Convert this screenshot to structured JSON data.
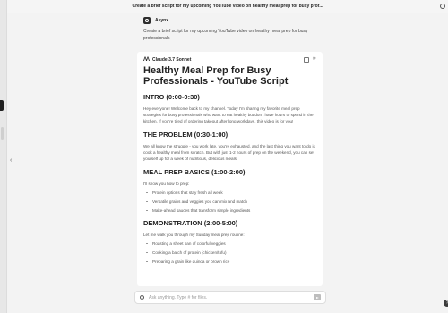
{
  "header": {
    "title": "Create a brief script for my upcoming YouTube video on healthy meal prep for busy prof..."
  },
  "user_message": {
    "name": "Asynx",
    "text": "Create a brief script for my upcoming YouTube video on healthy meal prep for busy professionals"
  },
  "response": {
    "model_name": "Claude 3.7 Sonnet",
    "title": "Healthy Meal Prep for Busy Professionals - YouTube Script",
    "sections": [
      {
        "heading": "INTRO (0:00-0:30)",
        "paragraph": "Hey everyone! Welcome back to my channel. Today I'm sharing my favorite meal prep strategies for busy professionals who want to eat healthy but don't have hours to spend in the kitchen. If you're tired of ordering takeout after long workdays, this video is for you!"
      },
      {
        "heading": "THE PROBLEM (0:30-1:00)",
        "paragraph": "We all know the struggle - you work late, you're exhausted, and the last thing you want to do is cook a healthy meal from scratch. But with just 1-2 hours of prep on the weekend, you can set yourself up for a week of nutritious, delicious meals."
      },
      {
        "heading": "MEAL PREP BASICS (1:00-2:00)",
        "paragraph": "I'll show you how to prep:",
        "bullets": [
          "Protein options that stay fresh all week",
          "Versatile grains and veggies you can mix and match",
          "Make-ahead sauces that transform simple ingredients"
        ]
      },
      {
        "heading": "DEMONSTRATION (2:00-5:00)",
        "paragraph": "Let me walk you through my Sunday meal prep routine:",
        "bullets": [
          "Roasting a sheet pan of colorful veggies",
          "Cooking a batch of protein (chicken/tofu)",
          "Preparing a grain like quinoa or brown rice"
        ]
      }
    ]
  },
  "input": {
    "placeholder": "Ask anything. Type # for files."
  },
  "help": {
    "label": "?"
  },
  "icons": {
    "back": "back-arrow-icon",
    "settings": "gear-icon",
    "model": "anthropic-logo-icon",
    "copy": "copy-icon",
    "regenerate": "refresh-icon",
    "attach": "attach-icon",
    "send": "send-icon",
    "sidebar_toggle": "chevron-left-icon"
  }
}
